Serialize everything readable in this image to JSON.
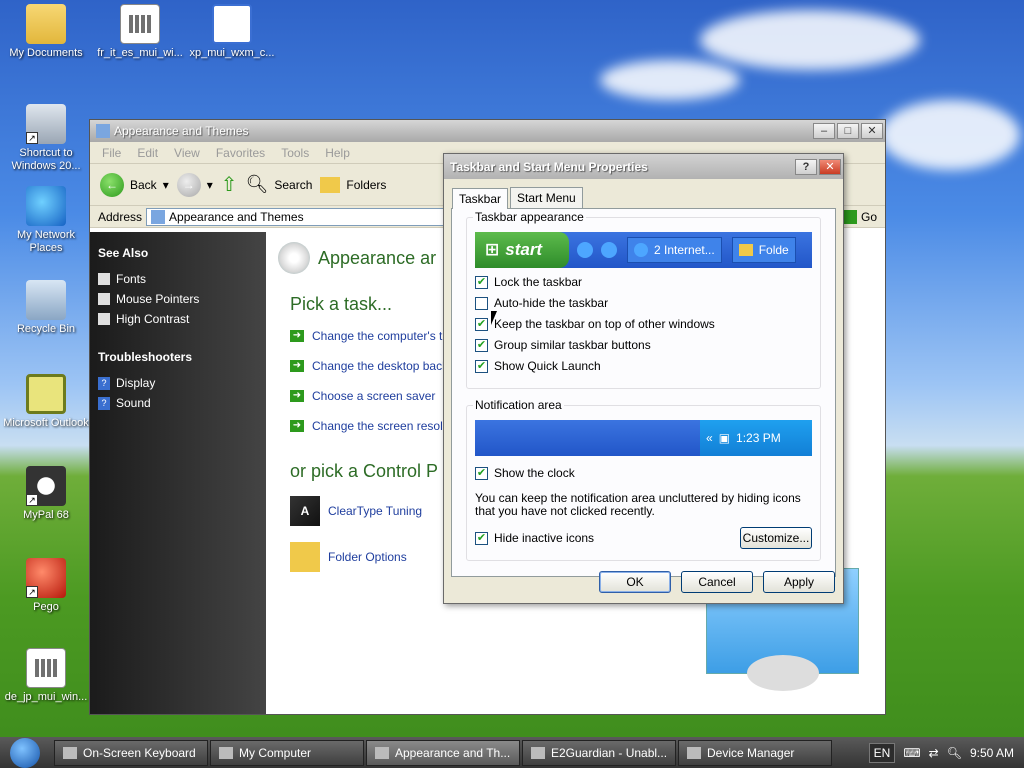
{
  "desktop": {
    "icons": [
      {
        "label": "My Documents"
      },
      {
        "label": "fr_it_es_mui_wi..."
      },
      {
        "label": "xp_mui_wxm_c..."
      },
      {
        "label": "Shortcut to Windows 20..."
      },
      {
        "label": "My Network Places"
      },
      {
        "label": "Recycle Bin"
      },
      {
        "label": "Microsoft Outlook"
      },
      {
        "label": "MyPal 68"
      },
      {
        "label": "Pego"
      },
      {
        "label": "de_jp_mui_win..."
      }
    ]
  },
  "explorer": {
    "title": "Appearance and Themes",
    "menu": [
      "File",
      "Edit",
      "View",
      "Favorites",
      "Tools",
      "Help"
    ],
    "toolbar": {
      "back": "Back",
      "search": "Search",
      "folders": "Folders"
    },
    "address_label": "Address",
    "address_value": "Appearance and Themes",
    "go": "Go",
    "see_also": "See Also",
    "see_also_items": [
      "Fonts",
      "Mouse Pointers",
      "High Contrast"
    ],
    "troubleshooters": "Troubleshooters",
    "troubleshooter_items": [
      "Display",
      "Sound"
    ],
    "page_title": "Appearance ar",
    "pick_task": "Pick a task...",
    "tasks": [
      "Change the computer's th",
      "Change the desktop back",
      "Choose a screen saver",
      "Change the screen resolu"
    ],
    "pick_cp": "or pick a Control P",
    "cp_items": [
      "ClearType Tuning",
      "Folder Options"
    ]
  },
  "dialog": {
    "title": "Taskbar and Start Menu Properties",
    "tabs": [
      "Taskbar",
      "Start Menu"
    ],
    "appearance_legend": "Taskbar appearance",
    "preview": {
      "start": "start",
      "item1": "2 Internet...",
      "item2": "Folde"
    },
    "checks": [
      {
        "label": "Lock the taskbar",
        "checked": true
      },
      {
        "label": "Auto-hide the taskbar",
        "checked": false
      },
      {
        "label": "Keep the taskbar on top of other windows",
        "checked": true
      },
      {
        "label": "Group similar taskbar buttons",
        "checked": true
      },
      {
        "label": "Show Quick Launch",
        "checked": true
      }
    ],
    "notif_legend": "Notification area",
    "tray_time": "1:23 PM",
    "show_clock": "Show the clock",
    "notif_text": "You can keep the notification area uncluttered by hiding icons that you have not clicked recently.",
    "hide_inactive": "Hide inactive icons",
    "customize": "Customize...",
    "ok": "OK",
    "cancel": "Cancel",
    "apply": "Apply"
  },
  "taskbar": {
    "items": [
      "On-Screen Keyboard",
      "My Computer",
      "Appearance and Th...",
      "E2Guardian - Unabl...",
      "Device Manager"
    ],
    "lang": "EN",
    "time": "9:50 AM"
  }
}
